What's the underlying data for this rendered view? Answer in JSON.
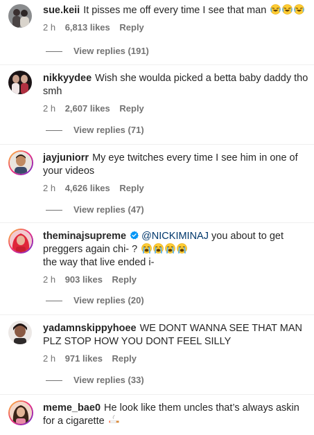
{
  "comments": [
    {
      "username": "sue.keii",
      "text": "It pisses me off every time I see that man",
      "time": "2 h",
      "likes": "6,813 likes",
      "reply": "Reply",
      "view_replies": "View replies (191)"
    },
    {
      "username": "nikkyydee",
      "text": "Wish she woulda picked a betta baby daddy tho smh",
      "time": "2 h",
      "likes": "2,607 likes",
      "reply": "Reply",
      "view_replies": "View replies (71)"
    },
    {
      "username": "jayjuniorr",
      "text": "My eye twitches every time I see him in one of your videos",
      "time": "2 h",
      "likes": "4,626 likes",
      "reply": "Reply",
      "view_replies": "View replies (47)"
    },
    {
      "username": "theminajsupreme",
      "mention": "@NICKIMINAJ",
      "text": "you about to get preggers again chi- ?",
      "text2": "the way that live ended i-",
      "time": "2 h",
      "likes": "903 likes",
      "reply": "Reply",
      "view_replies": "View replies (20)"
    },
    {
      "username": "yadamnskippyhoee",
      "text": "WE DONT WANNA SEE THAT MAN PLZ STOP HOW YOU DONT FEEL SILLY",
      "time": "2 h",
      "likes": "971 likes",
      "reply": "Reply",
      "view_replies": "View replies (33)"
    },
    {
      "username": "meme_bae0",
      "text": "He look like them uncles that’s always askin for a cigarette"
    }
  ],
  "icons": {
    "laughing": "face-with-tears-of-joy-icon",
    "crying": "loudly-crying-face-icon",
    "cigarette": "cigarette-icon",
    "verified": "verified-badge-icon"
  },
  "colors": {
    "text": "#262626",
    "secondary": "#737373",
    "mention": "#00376b",
    "verified": "#0095f6"
  }
}
